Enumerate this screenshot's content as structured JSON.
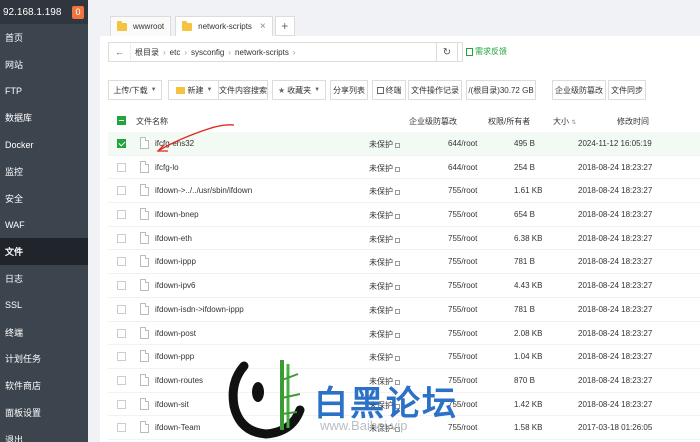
{
  "sidebar": {
    "ip": "92.168.1.198",
    "badge": "0",
    "items": [
      {
        "label": "首页"
      },
      {
        "label": "网站"
      },
      {
        "label": "FTP"
      },
      {
        "label": "数据库"
      },
      {
        "label": "Docker"
      },
      {
        "label": "监控"
      },
      {
        "label": "安全"
      },
      {
        "label": "WAF"
      },
      {
        "label": "文件",
        "active": true
      },
      {
        "label": "日志"
      },
      {
        "label": "SSL"
      },
      {
        "label": "终端"
      },
      {
        "label": "计划任务"
      },
      {
        "label": "软件商店"
      },
      {
        "label": "面板设置"
      },
      {
        "label": "退出"
      }
    ]
  },
  "tabs": [
    {
      "label": "wwwroot"
    },
    {
      "label": "network-scripts",
      "close": "×"
    }
  ],
  "tab_add": "+",
  "path": {
    "back": "←",
    "crumbs": [
      "根目录",
      "etc",
      "sysconfig",
      "network-scripts"
    ],
    "sep": "›",
    "refresh": "↻",
    "feedback": "需求反馈"
  },
  "toolbar": {
    "upload": "上传/下载",
    "new": "新建",
    "search": "文件内容搜索",
    "favorites": "收藏夹",
    "share": "分享列表",
    "terminal": "终端",
    "oplog": "文件操作记录",
    "disk": "/(根目录)30.72 GB",
    "enterprise": "企业级防篡改",
    "sync": "文件同步"
  },
  "columns": {
    "name": "文件名称",
    "protect": "企业级防篡改",
    "perm": "权限/所有者",
    "size": "大小",
    "mtime": "修改时间"
  },
  "files": [
    {
      "name": "ifcfg-ens32",
      "protect": "未保护",
      "perm": "644/root",
      "size": "495 B",
      "mtime": "2024-11-12 16:05:19",
      "selected": true
    },
    {
      "name": "ifcfg-lo",
      "protect": "未保护",
      "perm": "644/root",
      "size": "254 B",
      "mtime": "2018-08-24 18:23:27"
    },
    {
      "name": "ifdown->../../usr/sbin/ifdown",
      "protect": "未保护",
      "perm": "755/root",
      "size": "1.61 KB",
      "mtime": "2018-08-24 18:23:27"
    },
    {
      "name": "ifdown-bnep",
      "protect": "未保护",
      "perm": "755/root",
      "size": "654 B",
      "mtime": "2018-08-24 18:23:27"
    },
    {
      "name": "ifdown-eth",
      "protect": "未保护",
      "perm": "755/root",
      "size": "6.38 KB",
      "mtime": "2018-08-24 18:23:27"
    },
    {
      "name": "ifdown-ippp",
      "protect": "未保护",
      "perm": "755/root",
      "size": "781 B",
      "mtime": "2018-08-24 18:23:27"
    },
    {
      "name": "ifdown-ipv6",
      "protect": "未保护",
      "perm": "755/root",
      "size": "4.43 KB",
      "mtime": "2018-08-24 18:23:27"
    },
    {
      "name": "ifdown-isdn->ifdown-ippp",
      "protect": "未保护",
      "perm": "755/root",
      "size": "781 B",
      "mtime": "2018-08-24 18:23:27"
    },
    {
      "name": "ifdown-post",
      "protect": "未保护",
      "perm": "755/root",
      "size": "2.08 KB",
      "mtime": "2018-08-24 18:23:27"
    },
    {
      "name": "ifdown-ppp",
      "protect": "未保护",
      "perm": "755/root",
      "size": "1.04 KB",
      "mtime": "2018-08-24 18:23:27"
    },
    {
      "name": "ifdown-routes",
      "protect": "未保护",
      "perm": "755/root",
      "size": "870 B",
      "mtime": "2018-08-24 18:23:27"
    },
    {
      "name": "ifdown-sit",
      "protect": "未保护",
      "perm": "755/root",
      "size": "1.42 KB",
      "mtime": "2018-08-24 18:23:27"
    },
    {
      "name": "ifdown-Team",
      "protect": "未保护",
      "perm": "755/root",
      "size": "1.58 KB",
      "mtime": "2017-03-18 01:26:05"
    }
  ],
  "watermark": {
    "text": "白黑论坛",
    "url": "www.Baihei.vip"
  },
  "colors": {
    "accent_green": "#20a53a",
    "sidebar_bg": "#3c444d",
    "watermark_blue": "#2a71c7",
    "annotation_red": "#e0261f"
  }
}
